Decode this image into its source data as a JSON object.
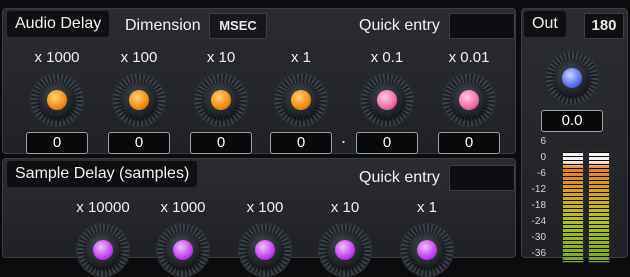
{
  "audio_delay": {
    "title": "Audio Delay",
    "dimension_label": "Dimension",
    "dimension_value": "MSEC",
    "quick_entry_label": "Quick entry",
    "decimal_separator": ".",
    "knobs": [
      {
        "label": "x 1000",
        "value": "0",
        "color": "#f08c12"
      },
      {
        "label": "x 100",
        "value": "0",
        "color": "#f08c12"
      },
      {
        "label": "x 10",
        "value": "0",
        "color": "#f08c12"
      },
      {
        "label": "x 1",
        "value": "0",
        "color": "#f08c12"
      },
      {
        "label": "x 0.1",
        "value": "0",
        "color": "#f06aa8"
      },
      {
        "label": "x 0.01",
        "value": "0",
        "color": "#f06aa8"
      }
    ]
  },
  "sample_delay": {
    "title": "Sample Delay (samples)",
    "quick_entry_label": "Quick entry",
    "knobs": [
      {
        "label": "x 10000",
        "color": "#c040f0"
      },
      {
        "label": "x 1000",
        "color": "#c040f0"
      },
      {
        "label": "x 100",
        "color": "#c040f0"
      },
      {
        "label": "x 10",
        "color": "#c040f0"
      },
      {
        "label": "x 1",
        "color": "#c040f0"
      }
    ]
  },
  "out": {
    "title": "Out",
    "channel": "180",
    "value": "0.0",
    "color": "#5a70f0",
    "meter_scale": [
      "6",
      "0",
      "-6",
      "-12",
      "-18",
      "-24",
      "-30",
      "-36"
    ]
  }
}
